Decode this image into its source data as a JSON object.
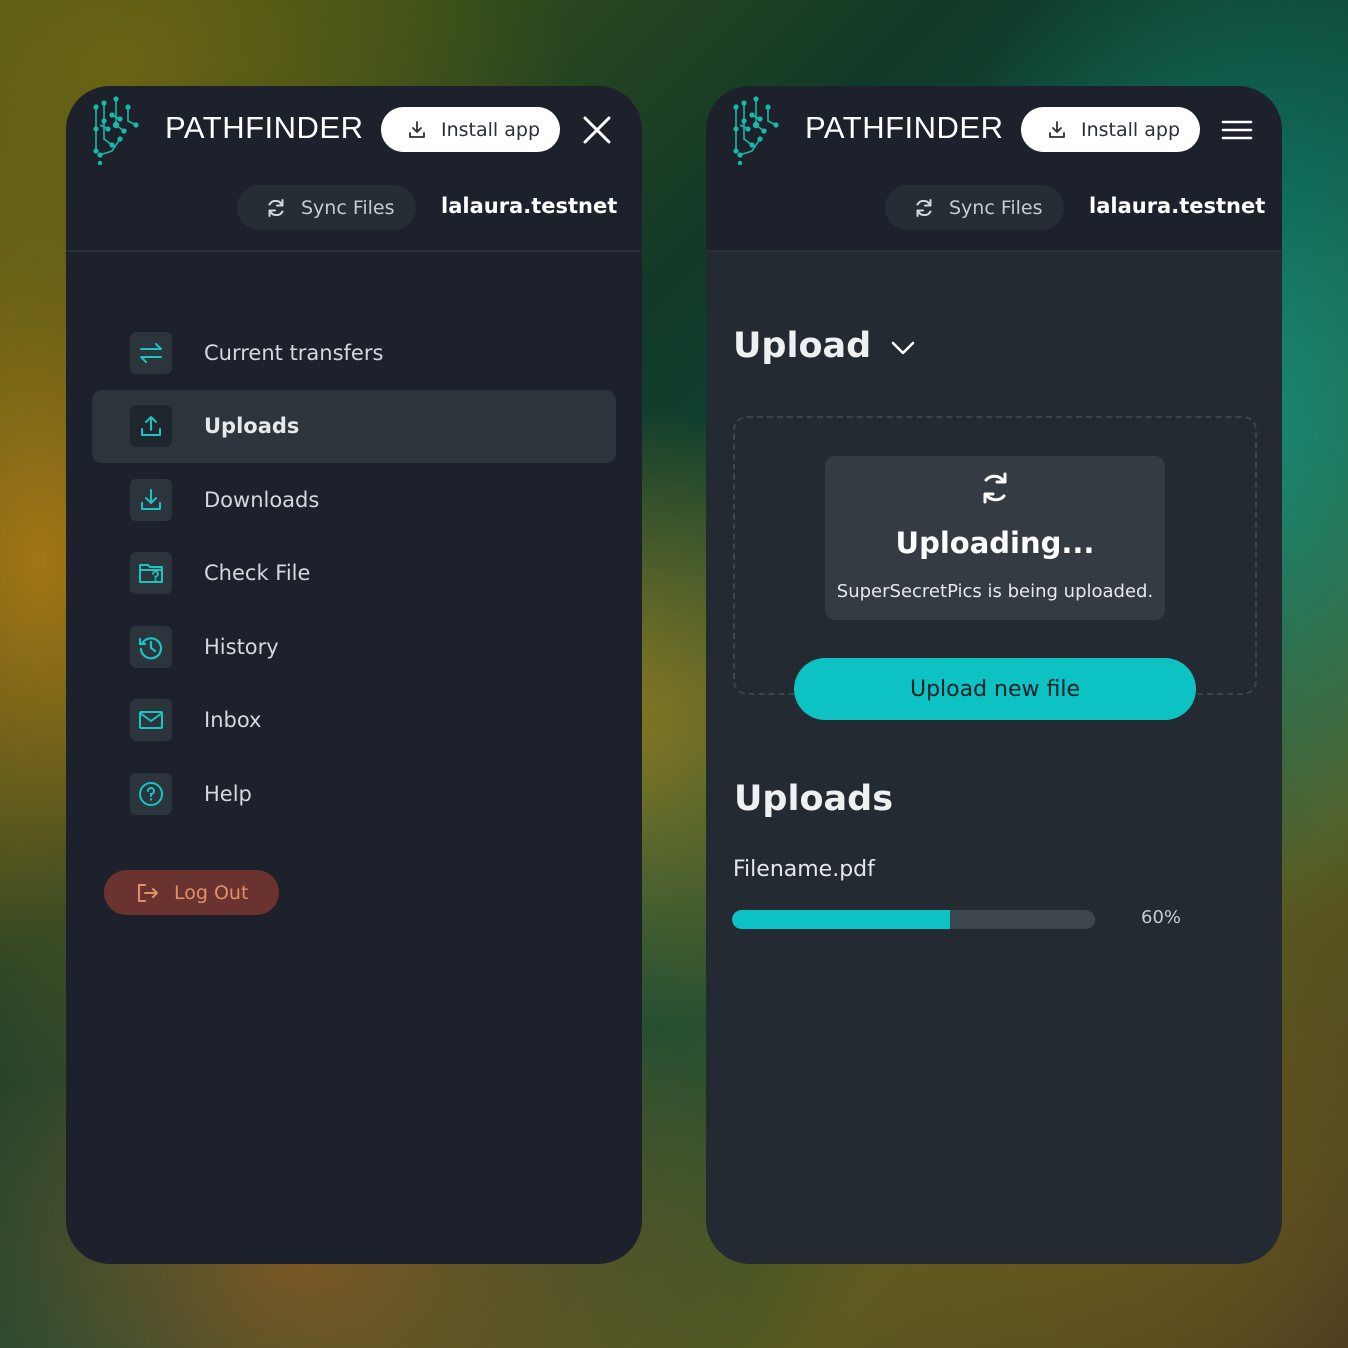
{
  "brand": "PATHFINDER",
  "header": {
    "install_label": "Install app",
    "sync_label": "Sync Files",
    "account": "lalaura.testnet"
  },
  "sidebar": {
    "items": [
      {
        "label": "Current transfers",
        "icon": "transfer-arrows-icon",
        "active": false
      },
      {
        "label": "Uploads",
        "icon": "upload-icon",
        "active": true
      },
      {
        "label": "Downloads",
        "icon": "download-icon",
        "active": false
      },
      {
        "label": "Check File",
        "icon": "folder-question-icon",
        "active": false
      },
      {
        "label": "History",
        "icon": "history-icon",
        "active": false
      },
      {
        "label": "Inbox",
        "icon": "mail-icon",
        "active": false
      },
      {
        "label": "Help",
        "icon": "help-circle-icon",
        "active": false
      }
    ],
    "logout_label": "Log Out"
  },
  "upload_page": {
    "title": "Upload",
    "status_title": "Uploading...",
    "status_desc": "SuperSecretPics is being uploaded.",
    "upload_new_label": "Upload new file",
    "uploads_heading": "Uploads",
    "uploads": [
      {
        "filename": "Filename.pdf",
        "progress": 0.6,
        "progress_label": "60%"
      }
    ]
  },
  "colors": {
    "accent": "#0cc2c2",
    "panel_dark": "#1c212b",
    "panel_mid": "#232a31",
    "logout_bg": "#6a3330",
    "logout_text": "#e0906a"
  }
}
